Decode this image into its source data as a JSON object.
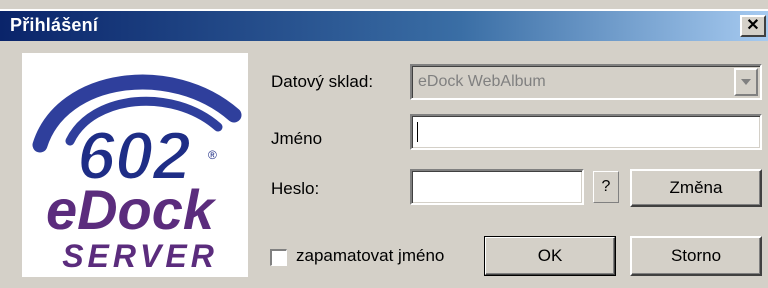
{
  "window": {
    "title": "Přihlášení",
    "close_glyph": "✕"
  },
  "logo": {
    "number": "602",
    "product": "eDock",
    "tagline": "SERVER",
    "registered_mark": "®",
    "colors": {
      "navy": "#1e2d86",
      "purple": "#5b2c7d",
      "swoosh": "#2f3f9c"
    }
  },
  "form": {
    "store_label": "Datový sklad:",
    "store_value": "eDock WebAlbum",
    "name_label": "Jméno",
    "name_value": "",
    "password_label": "Heslo:",
    "password_value": "",
    "help_label": "?",
    "change_label": "Změna",
    "remember_label": "zapamatovat jméno",
    "remember_checked": false
  },
  "buttons": {
    "ok_label": "OK",
    "cancel_label": "Storno"
  }
}
